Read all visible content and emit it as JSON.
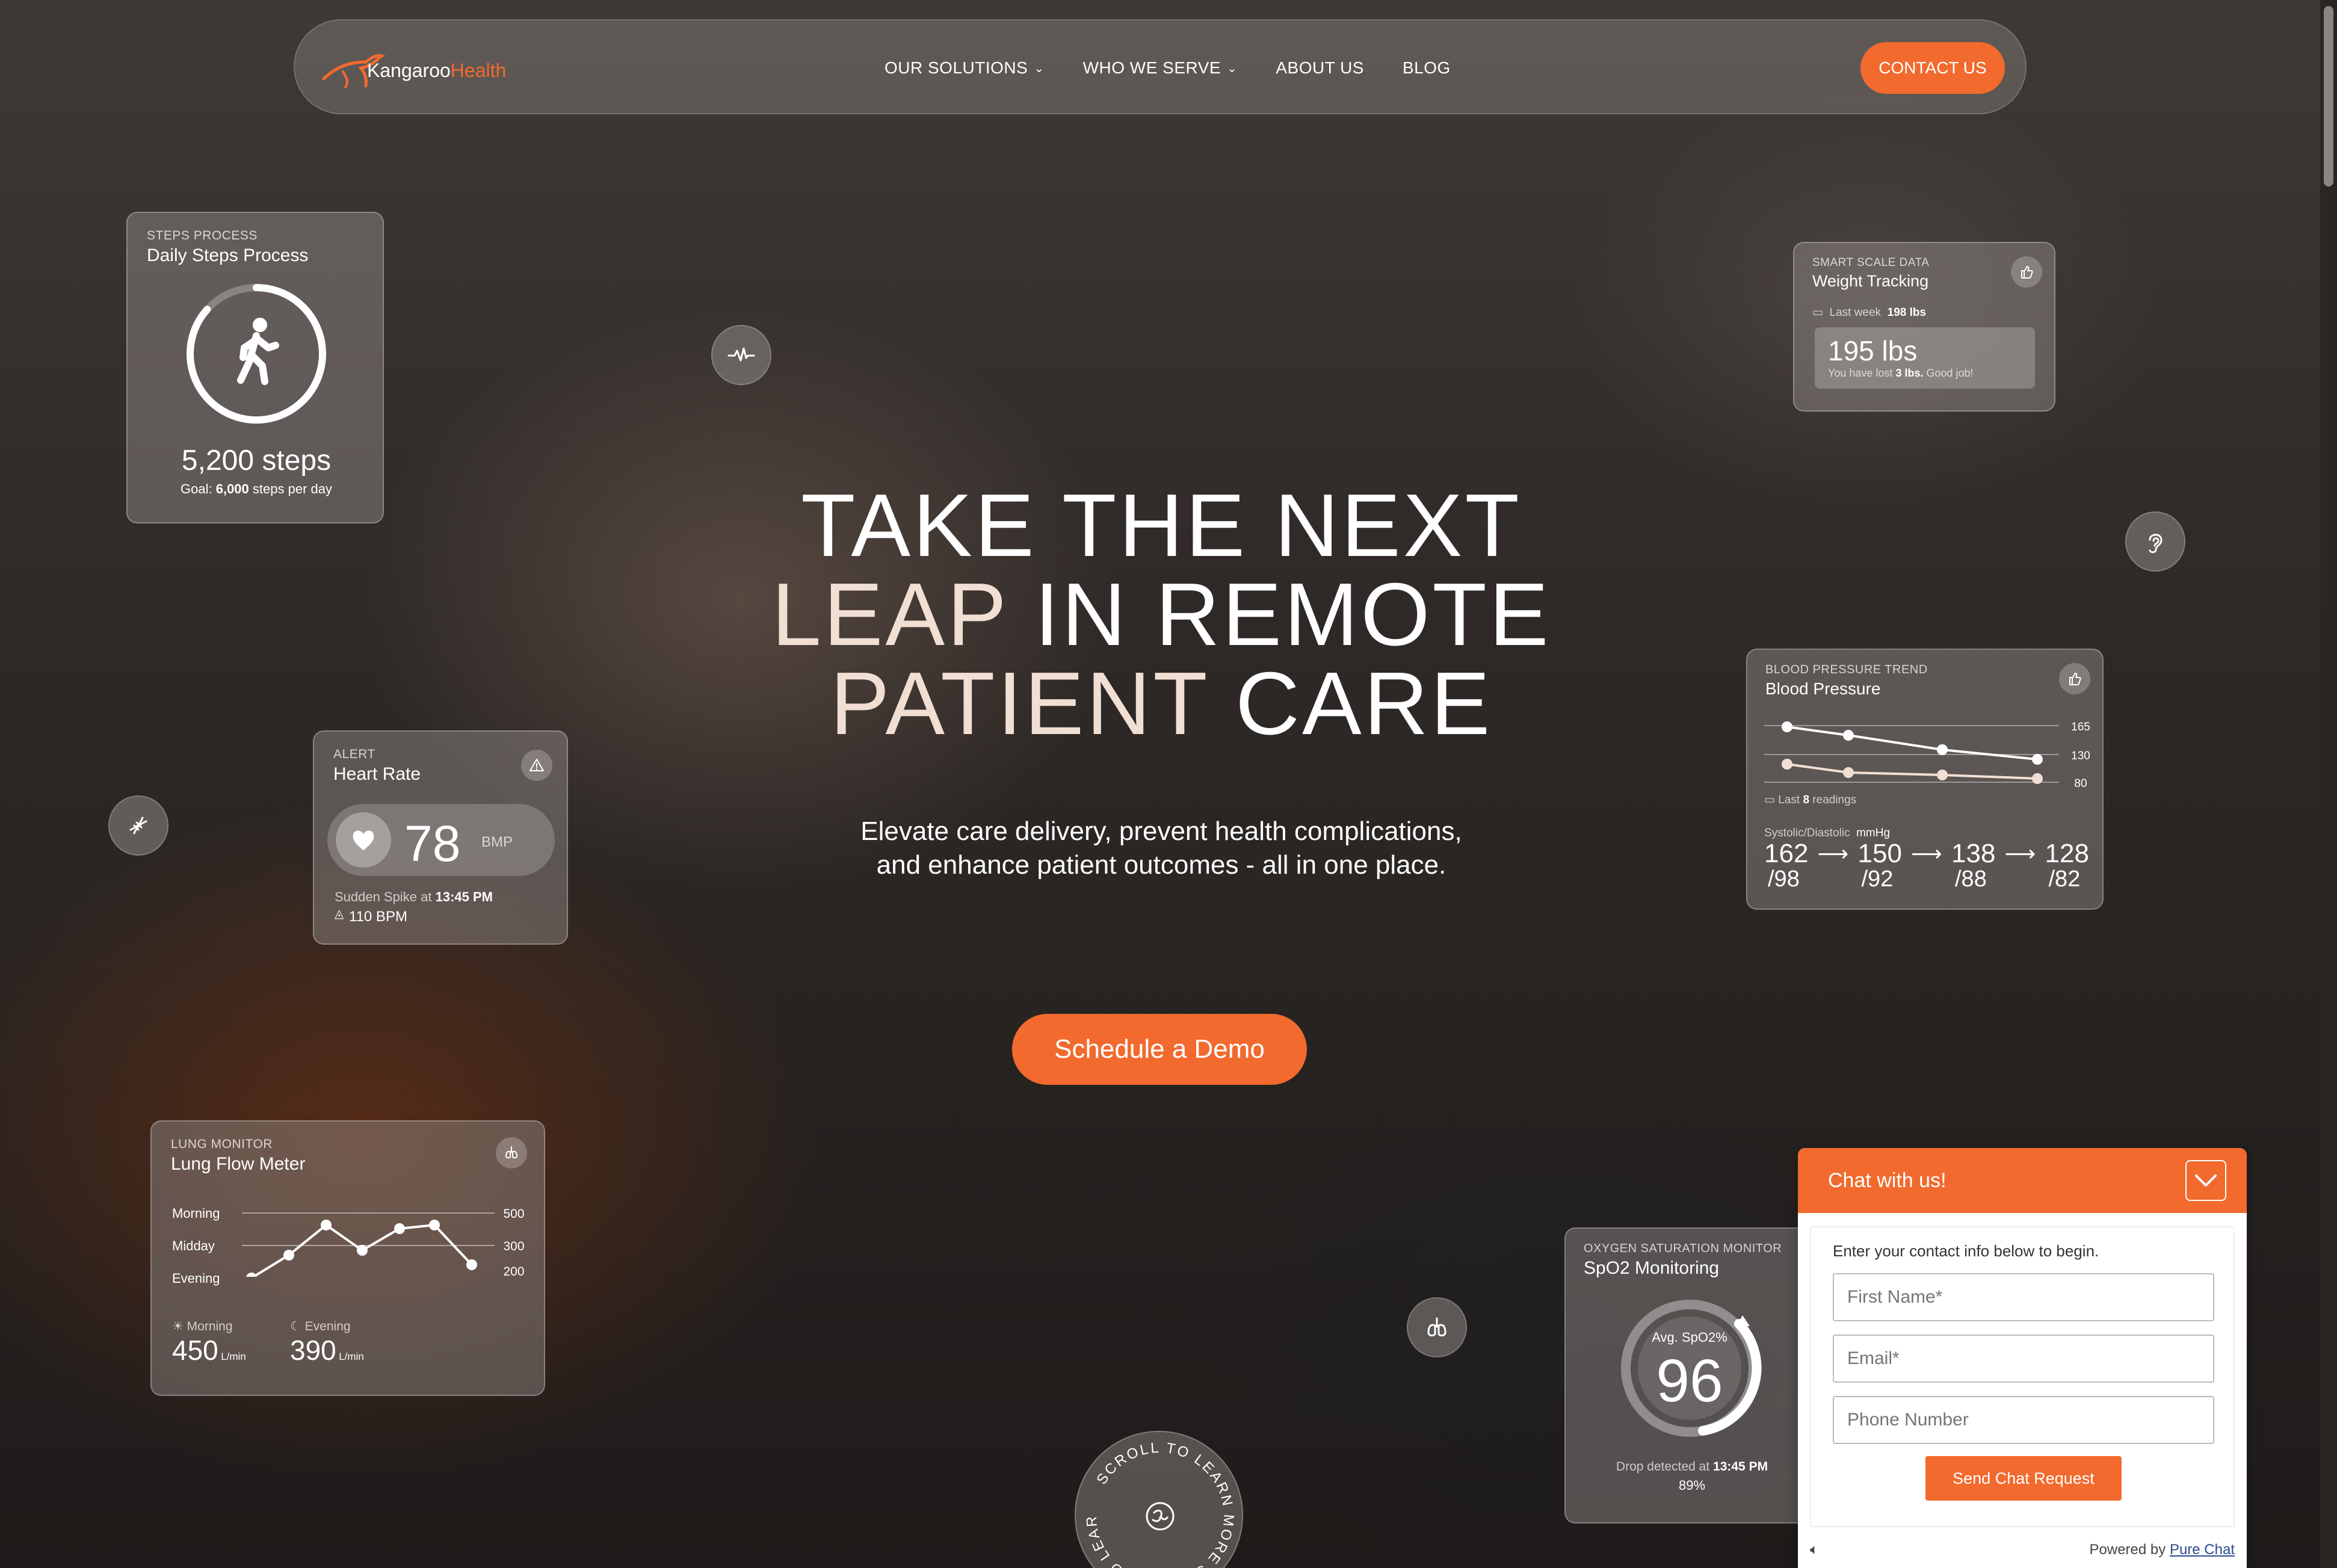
{
  "brand": {
    "name_part1": "Kangaroo",
    "name_part2": "Health",
    "accent": "#f26a2e"
  },
  "nav": {
    "items": [
      {
        "label": "OUR SOLUTIONS",
        "dropdown": true
      },
      {
        "label": "WHO WE SERVE",
        "dropdown": true
      },
      {
        "label": "ABOUT US",
        "dropdown": false
      },
      {
        "label": "BLOG",
        "dropdown": false
      }
    ],
    "contact_label": "CONTACT US"
  },
  "hero": {
    "line1": "TAKE THE NEXT",
    "line2a": "LEAP",
    "line2b": " IN REMOTE",
    "line3a": "PATIENT",
    "line3b": " CARE",
    "subtitle_1": "Elevate care delivery, prevent health complications,",
    "subtitle_2": "and enhance patient outcomes - all in one place.",
    "cta": "Schedule a Demo"
  },
  "steps": {
    "overline": "STEPS PROCESS",
    "title": "Daily Steps Process",
    "value": "5,200 steps",
    "goal_prefix": "Goal:",
    "goal_value": "6,000",
    "goal_suffix": "steps per day",
    "progress": 0.8667
  },
  "weight": {
    "overline": "SMART SCALE DATA",
    "title": "Weight Tracking",
    "last_week_label": "Last week",
    "last_week_value": "198 lbs",
    "value": "195 lbs",
    "note_prefix": "You have lost",
    "note_bold": "3 lbs.",
    "note_suffix": "Good job!"
  },
  "heart": {
    "overline": "ALERT",
    "title": "Heart Rate",
    "value": "78",
    "unit": "BMP",
    "spike_prefix": "Sudden Spike at",
    "spike_time": "13:45 PM",
    "spike_value": "110 BPM"
  },
  "bp": {
    "overline": "BLOOD PRESSURE TREND",
    "title": "Blood Pressure",
    "axis": [
      "165",
      "130",
      "80"
    ],
    "last_label": "Last",
    "last_count": "8",
    "last_suffix": "readings",
    "units_label": "Systolic/Diastolic",
    "units": "mmHg",
    "readings": [
      {
        "sys": "162",
        "dia": "/98"
      },
      {
        "sys": "150",
        "dia": "/92"
      },
      {
        "sys": "138",
        "dia": "/88"
      },
      {
        "sys": "128",
        "dia": "/82"
      }
    ]
  },
  "lung": {
    "overline": "LUNG MONITOR",
    "title": "Lung Flow Meter",
    "rows": [
      "Morning",
      "Midday",
      "Evening"
    ],
    "axis": [
      "500",
      "300",
      "200"
    ],
    "morning_label": "Morning",
    "morning_value": "450",
    "evening_label": "Evening",
    "evening_value": "390",
    "unit": "L/min"
  },
  "spo2": {
    "overline": "OXYGEN SATURATION MONITOR",
    "title": "SpO2 Monitoring",
    "avg_label": "Avg. SpO2%",
    "value": "96",
    "drop_prefix": "Drop detected at",
    "drop_time": "13:45 PM",
    "drop_value": "89%"
  },
  "scroll": {
    "text": "SCROLL TO LEARN MORE SCROLL TO LEARN MORE "
  },
  "chat": {
    "title": "Chat with us!",
    "intro": "Enter your contact info below to begin.",
    "first_name_ph": "First Name*",
    "email_ph": "Email*",
    "phone_ph": "Phone Number",
    "send": "Send Chat Request",
    "powered_prefix": "Powered by",
    "powered_link": "Pure Chat"
  }
}
